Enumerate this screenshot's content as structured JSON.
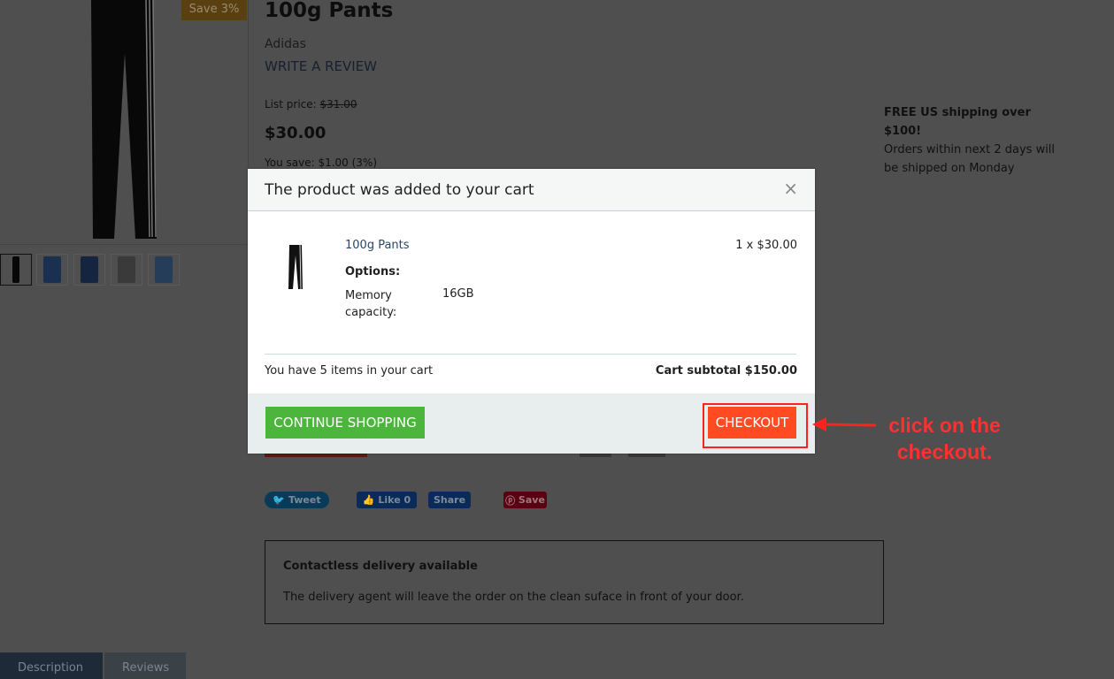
{
  "product": {
    "badge": "Save 3%",
    "title": "100g Pants",
    "brand": "Adidas",
    "write_review": "WRITE A REVIEW",
    "list_price_label": "List price:",
    "list_price": "$31.00",
    "price": "$30.00",
    "you_save": "You save: $1.00 (3%)"
  },
  "shipping": {
    "title": "FREE US shipping over $100!",
    "text": "Orders within next 2 days will be shipped on Monday"
  },
  "social": {
    "tweet": "Tweet",
    "like": "Like 0",
    "share": "Share",
    "pin": "Save"
  },
  "delivery": {
    "title": "Contactless delivery available",
    "text": "The delivery agent will leave the order on the clean suface in front of your door."
  },
  "tabs": [
    {
      "label": "Description"
    },
    {
      "label": "Reviews"
    }
  ],
  "modal": {
    "title": "The product was added to your cart",
    "close": "×",
    "item_name": "100g Pants",
    "item_qty": "1 x $30.00",
    "options_label": "Options:",
    "option_name": "Memory capacity:",
    "option_value": "16GB",
    "cart_count": "You have 5 items in your cart",
    "subtotal": "Cart subtotal $150.00",
    "continue": "CONTINUE SHOPPING",
    "checkout": "CHECKOUT"
  },
  "annotation": {
    "text": "click on the checkout.",
    "color": "#ff3030"
  },
  "colors": {
    "continue": "#4cb63c",
    "checkout": "#ff4a22"
  }
}
